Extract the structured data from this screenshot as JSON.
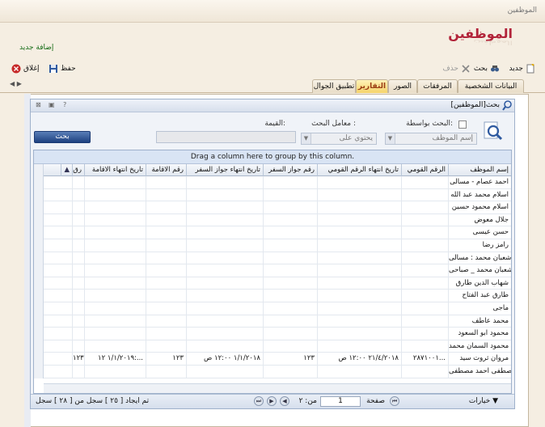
{
  "window": {
    "title": "الموظفين"
  },
  "page": {
    "title": "الموظفين",
    "add_new_link": "إضافة جديد"
  },
  "toolbar": {
    "new_label": "جديد",
    "search_label": "بحث",
    "delete_label": "حذف",
    "save_label": "حفظ",
    "close_label": "إغلاق"
  },
  "tabs": [
    {
      "label": "البيانات الشخصية",
      "active": false
    },
    {
      "label": "المرفقات",
      "active": false
    },
    {
      "label": "الصور",
      "active": false
    },
    {
      "label": "التقارير",
      "active": true
    },
    {
      "label": "تطبيق الجوال",
      "active": false
    }
  ],
  "search_panel": {
    "title": "بحث[الموظفين]",
    "search_by_label": "البحث بواسطة:",
    "field_value": "إسم الموظف",
    "operator_label": "معامل البحث :",
    "operator_value": "يحتوي على",
    "value_label": "القيمة:",
    "value": "",
    "search_button": "بحث"
  },
  "grid": {
    "group_hint": "Drag a column here to group by this column.",
    "columns": [
      "إسم الموظف",
      "الرقم القومي",
      "تاريخ انتهاء الرقم القومي",
      "رقم جواز السفر",
      "تاريخ انتهاء جواز السفر",
      "رقم الاقامة",
      "تاريخ انتهاء الاقامة",
      "رق"
    ],
    "rows": [
      [
        "احمد عصام - مسالى",
        "",
        "",
        "",
        "",
        "",
        "",
        ""
      ],
      [
        "اسلام محمد عبد الله",
        "",
        "",
        "",
        "",
        "",
        "",
        ""
      ],
      [
        "اسلام محمود حسين",
        "",
        "",
        "",
        "",
        "",
        "",
        ""
      ],
      [
        "جلال معوض",
        "",
        "",
        "",
        "",
        "",
        "",
        ""
      ],
      [
        "حسن عيسى",
        "",
        "",
        "",
        "",
        "",
        "",
        ""
      ],
      [
        "رامز رضا",
        "",
        "",
        "",
        "",
        "",
        "",
        ""
      ],
      [
        "شعبان محمد : مسالى",
        "",
        "",
        "",
        "",
        "",
        "",
        ""
      ],
      [
        "شعبان محمد _ صباحى",
        "",
        "",
        "",
        "",
        "",
        "",
        ""
      ],
      [
        "شهاب الدين طارق",
        "",
        "",
        "",
        "",
        "",
        "",
        ""
      ],
      [
        "طارق عبد الفتاح",
        "",
        "",
        "",
        "",
        "",
        "",
        ""
      ],
      [
        "ماجى",
        "",
        "",
        "",
        "",
        "",
        "",
        ""
      ],
      [
        "محمد عاطف",
        "",
        "",
        "",
        "",
        "",
        "",
        ""
      ],
      [
        "محمود ابو السعود",
        "",
        "",
        "",
        "",
        "",
        "",
        ""
      ],
      [
        "محمود السمان محمد",
        "",
        "",
        "",
        "",
        "",
        "",
        ""
      ],
      [
        "مروان ثروت سيد",
        "٢٨٧١٠٠١...",
        "٢١/٤/٢٠١٨ ١٢:٠٠ ص",
        "١٢٣",
        "١/١/٢٠١٨ ١٢:٠٠ ص",
        "١٢٣",
        "١/١/٢٠١٩ ١٢:...",
        "١٢٣"
      ],
      [
        "مصطفى احمد مصطفى...",
        "",
        "",
        "",
        "",
        "",
        "",
        ""
      ]
    ]
  },
  "pager": {
    "options_label": "خيارات",
    "page_label": "صفحة",
    "page_value": "1",
    "of_label": "من: ٢",
    "summary": "تم ايجاد [ ٢٥ ] سجل من [ ٢٨ ] سجل"
  },
  "colors": {
    "title_red": "#b2243a",
    "active_tab": "#f5d36a",
    "search_button": "#1e4180"
  }
}
